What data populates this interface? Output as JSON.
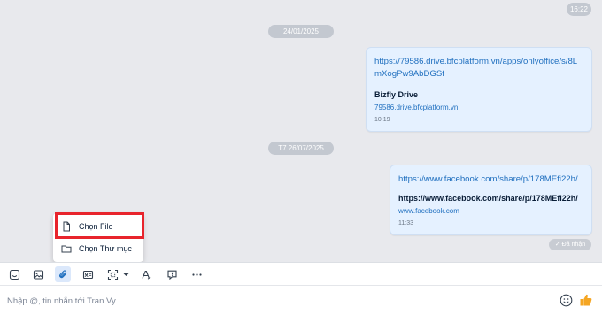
{
  "chat": {
    "top_time": "16:22",
    "date1": "24/01/2025",
    "date2": "T7 26/07/2025",
    "messages": [
      {
        "link": "https://79586.drive.bfcplatform.vn/apps/onlyoffice/s/8LmXogPw9AbDGSf",
        "card_title": "Bizfly Drive",
        "card_domain": "79586.drive.bfcplatform.vn",
        "time": "10:19"
      },
      {
        "link": "https://www.facebook.com/share/p/178MEfi22h/",
        "card_title": "https://www.facebook.com/share/p/178MEfi22h/",
        "card_domain": "www.facebook.com",
        "time": "11:33"
      }
    ],
    "status": "Đã nhận"
  },
  "attach_menu": {
    "items": [
      {
        "label": "Chọn File",
        "icon": "file-icon"
      },
      {
        "label": "Chọn Thư mục",
        "icon": "folder-icon"
      }
    ]
  },
  "toolbar": {
    "icons": [
      "sticker-icon",
      "image-icon",
      "attachment-icon",
      "contact-card-icon",
      "screenshot-icon",
      "chevron-down-icon",
      "format-text-icon",
      "quick-message-icon",
      "more-icon"
    ]
  },
  "composer": {
    "placeholder": "Nhập @, tin nhắn tới Tran Vy",
    "value": ""
  },
  "colors": {
    "accent": "#1f6fbf",
    "bubble": "#e5f1ff",
    "highlight": "#e8242c",
    "like": "#f5a623"
  }
}
